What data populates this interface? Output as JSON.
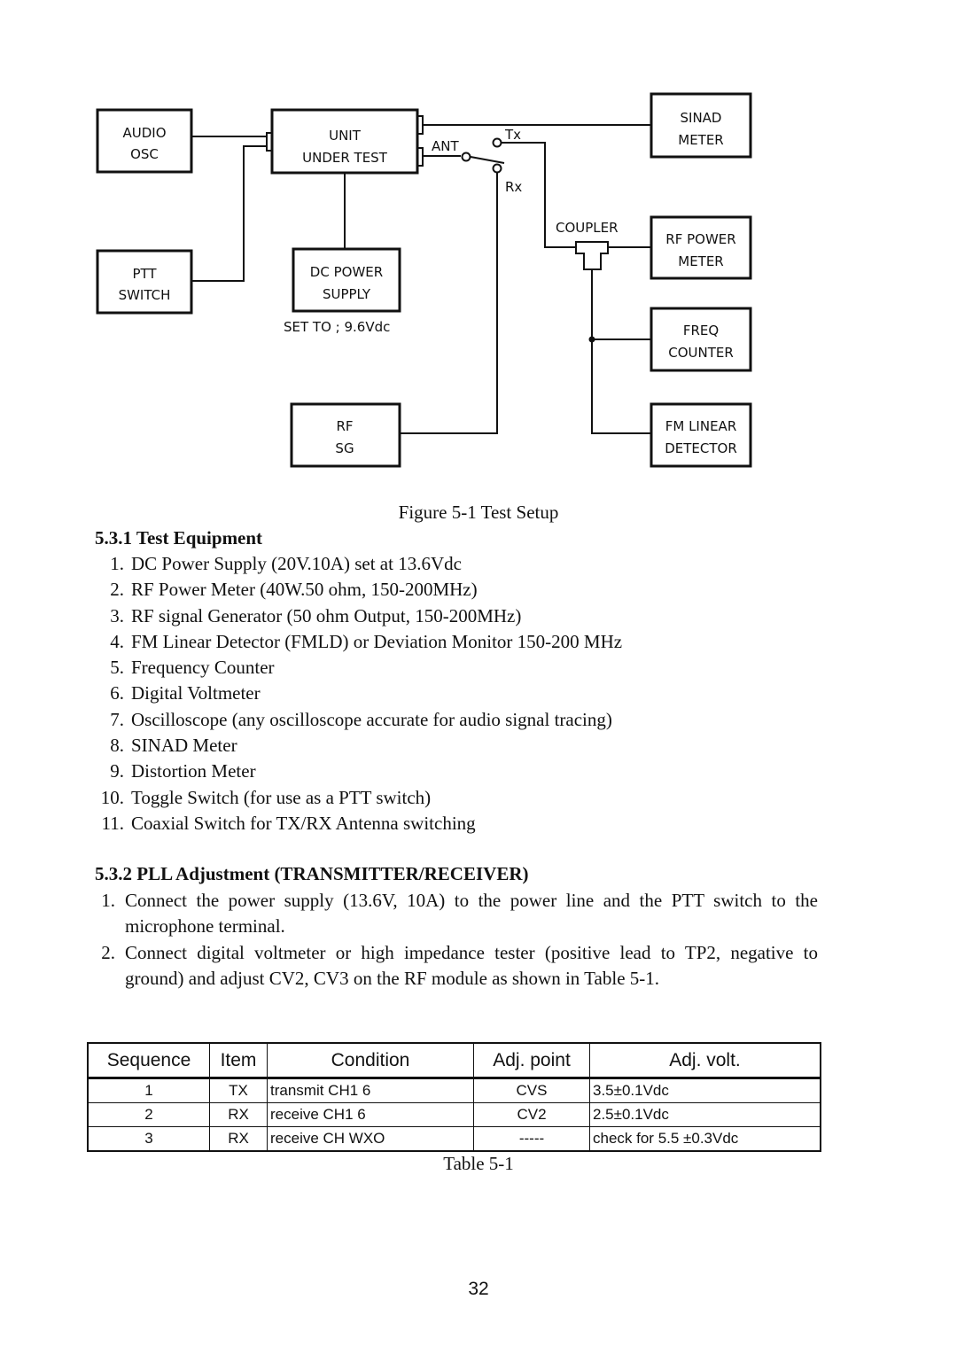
{
  "figure": {
    "blocks": {
      "audio_osc": [
        "AUDIO",
        "OSC"
      ],
      "unit_under_test": [
        "UNIT",
        "UNDER TEST"
      ],
      "ptt_switch": [
        "PTT",
        "SWITCH"
      ],
      "dc_power_supply": [
        "DC POWER",
        "SUPPLY"
      ],
      "rf_sg": [
        "RF",
        "SG"
      ],
      "sinad_meter": [
        "SINAD",
        "METER"
      ],
      "rf_power_meter": [
        "RF POWER",
        "METER"
      ],
      "freq_counter": [
        "FREQ",
        "COUNTER"
      ],
      "fm_linear_detector": [
        "FM LINEAR",
        "DETECTOR"
      ]
    },
    "labels": {
      "ant": "ANT",
      "tx": "Tx",
      "rx": "Rx",
      "coupler": "COUPLER",
      "set_to": "SET TO ; 9.6Vdc"
    },
    "caption": "Figure 5-1 Test Setup"
  },
  "section1": {
    "heading": "5.3.1 Test Equipment",
    "items": [
      {
        "num": "1.",
        "text": "DC Power Supply (20V.10A) set at 13.6Vdc"
      },
      {
        "num": "2.",
        "text": "RF Power Meter (40W.50 ohm, 150-200MHz)"
      },
      {
        "num": "3.",
        "text": "RF signal Generator (50 ohm Output, 150-200MHz)"
      },
      {
        "num": "4.",
        "text": "FM Linear Detector (FMLD) or Deviation Monitor 150-200 MHz"
      },
      {
        "num": "5.",
        "text": "Frequency Counter"
      },
      {
        "num": "6.",
        "text": "Digital Voltmeter"
      },
      {
        "num": "7.",
        "text": "Oscilloscope (any oscilloscope accurate for audio signal tracing)"
      },
      {
        "num": "8.",
        "text": "SINAD Meter"
      },
      {
        "num": "9.",
        "text": "Distortion Meter"
      },
      {
        "num": "10.",
        "text": "Toggle Switch (for use as a PTT switch)"
      },
      {
        "num": "11.",
        "text": "Coaxial Switch for TX/RX Antenna switching"
      }
    ]
  },
  "section2": {
    "heading": "5.3.2 PLL Adjustment (TRANSMITTER/RECEIVER)",
    "items": [
      {
        "num": "1.",
        "text": "Connect the power supply (13.6V, 10A) to the power line and the PTT switch to the microphone terminal."
      },
      {
        "num": "2.",
        "text": "Connect digital voltmeter or high impedance tester (positive lead to TP2, negative to ground) and adjust CV2, CV3 on the RF module as shown in Table 5-1."
      }
    ]
  },
  "table": {
    "headers": [
      "Sequence",
      "Item",
      "Condition",
      "Adj. point",
      "Adj. volt."
    ],
    "rows": [
      [
        "1",
        "TX",
        "transmit CH1 6",
        "CVS",
        "3.5±0.1Vdc"
      ],
      [
        "2",
        "RX",
        "receive CH1 6",
        "CV2",
        "2.5±0.1Vdc"
      ],
      [
        "3",
        "RX",
        "receive CH WXO",
        "-----",
        "check for 5.5 ±0.3Vdc"
      ]
    ],
    "caption": "Table 5-1"
  },
  "page_number": "32"
}
